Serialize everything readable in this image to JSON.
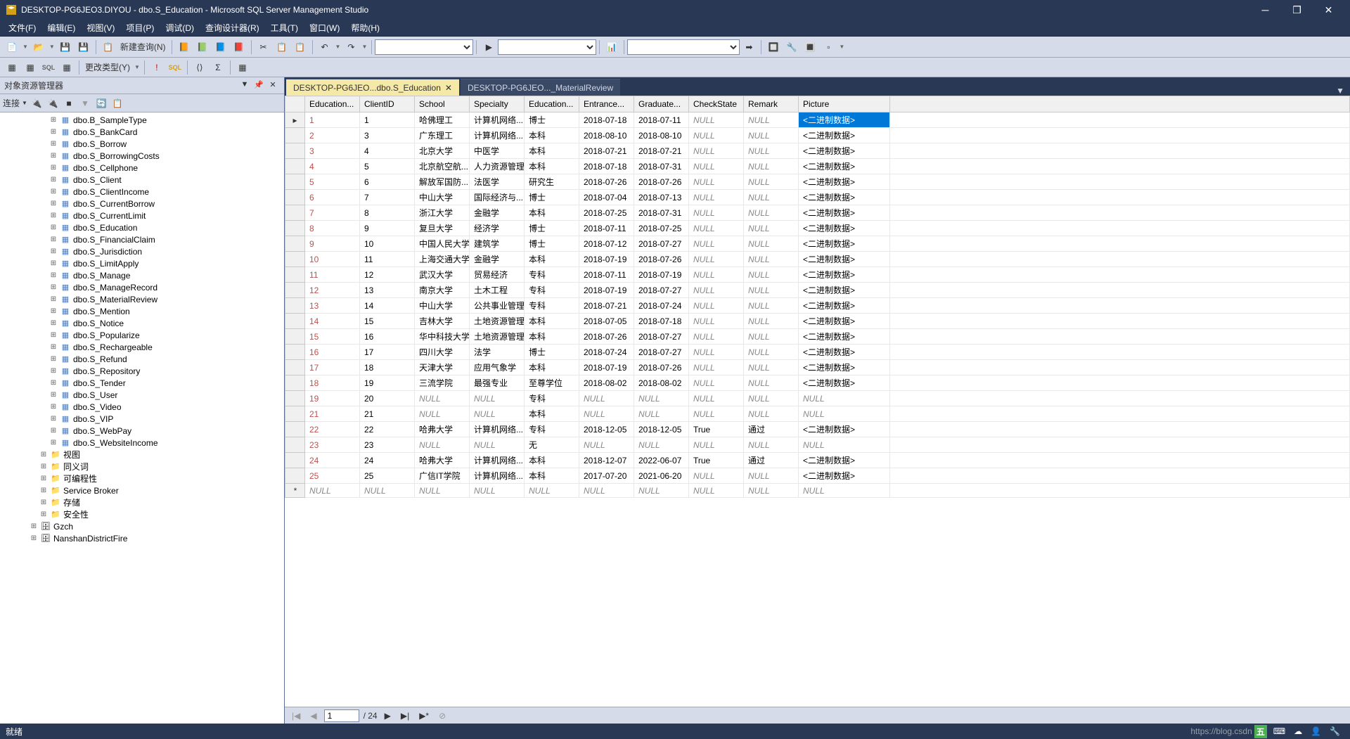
{
  "window": {
    "title": "DESKTOP-PG6JEO3.DIYOU - dbo.S_Education - Microsoft SQL Server Management Studio"
  },
  "menu": {
    "items": [
      "文件(F)",
      "编辑(E)",
      "视图(V)",
      "项目(P)",
      "调试(D)",
      "查询设计器(R)",
      "工具(T)",
      "窗口(W)",
      "帮助(H)"
    ]
  },
  "toolbar": {
    "new_query": "新建查询(N)",
    "change_type": "更改类型(Y)"
  },
  "explorer": {
    "title": "对象资源管理器",
    "connect": "连接",
    "tree": [
      {
        "depth": 3,
        "icon": "table",
        "label": "dbo.B_SampleType"
      },
      {
        "depth": 3,
        "icon": "table",
        "label": "dbo.S_BankCard"
      },
      {
        "depth": 3,
        "icon": "table",
        "label": "dbo.S_Borrow"
      },
      {
        "depth": 3,
        "icon": "table",
        "label": "dbo.S_BorrowingCosts"
      },
      {
        "depth": 3,
        "icon": "table",
        "label": "dbo.S_Cellphone"
      },
      {
        "depth": 3,
        "icon": "table",
        "label": "dbo.S_Client"
      },
      {
        "depth": 3,
        "icon": "table",
        "label": "dbo.S_ClientIncome"
      },
      {
        "depth": 3,
        "icon": "table",
        "label": "dbo.S_CurrentBorrow"
      },
      {
        "depth": 3,
        "icon": "table",
        "label": "dbo.S_CurrentLimit"
      },
      {
        "depth": 3,
        "icon": "table",
        "label": "dbo.S_Education"
      },
      {
        "depth": 3,
        "icon": "table",
        "label": "dbo.S_FinancialClaim"
      },
      {
        "depth": 3,
        "icon": "table",
        "label": "dbo.S_Jurisdiction"
      },
      {
        "depth": 3,
        "icon": "table",
        "label": "dbo.S_LimitApply"
      },
      {
        "depth": 3,
        "icon": "table",
        "label": "dbo.S_Manage"
      },
      {
        "depth": 3,
        "icon": "table",
        "label": "dbo.S_ManageRecord"
      },
      {
        "depth": 3,
        "icon": "table",
        "label": "dbo.S_MaterialReview"
      },
      {
        "depth": 3,
        "icon": "table",
        "label": "dbo.S_Mention"
      },
      {
        "depth": 3,
        "icon": "table",
        "label": "dbo.S_Notice"
      },
      {
        "depth": 3,
        "icon": "table",
        "label": "dbo.S_Popularize"
      },
      {
        "depth": 3,
        "icon": "table",
        "label": "dbo.S_Rechargeable"
      },
      {
        "depth": 3,
        "icon": "table",
        "label": "dbo.S_Refund"
      },
      {
        "depth": 3,
        "icon": "table",
        "label": "dbo.S_Repository"
      },
      {
        "depth": 3,
        "icon": "table",
        "label": "dbo.S_Tender"
      },
      {
        "depth": 3,
        "icon": "table",
        "label": "dbo.S_User"
      },
      {
        "depth": 3,
        "icon": "table",
        "label": "dbo.S_Video"
      },
      {
        "depth": 3,
        "icon": "table",
        "label": "dbo.S_VIP"
      },
      {
        "depth": 3,
        "icon": "table",
        "label": "dbo.S_WebPay"
      },
      {
        "depth": 3,
        "icon": "table",
        "label": "dbo.S_WebsiteIncome"
      },
      {
        "depth": 2,
        "icon": "folder",
        "label": "视图"
      },
      {
        "depth": 2,
        "icon": "folder",
        "label": "同义词"
      },
      {
        "depth": 2,
        "icon": "folder",
        "label": "可编程性"
      },
      {
        "depth": 2,
        "icon": "folder",
        "label": "Service Broker"
      },
      {
        "depth": 2,
        "icon": "folder",
        "label": "存储"
      },
      {
        "depth": 2,
        "icon": "folder",
        "label": "安全性"
      },
      {
        "depth": 1,
        "icon": "db",
        "label": "Gzch"
      },
      {
        "depth": 1,
        "icon": "db",
        "label": "NanshanDistrictFire"
      }
    ]
  },
  "tabs": {
    "items": [
      {
        "label": "DESKTOP-PG6JEO...dbo.S_Education",
        "active": true,
        "closable": true
      },
      {
        "label": "DESKTOP-PG6JEO..._MaterialReview",
        "active": false,
        "closable": false
      }
    ]
  },
  "grid": {
    "columns": [
      "Education...",
      "ClientID",
      "School",
      "Specialty",
      "Education...",
      "Entrance...",
      "Graduate...",
      "CheckState",
      "Remark",
      "Picture"
    ],
    "rows": [
      {
        "cells": [
          "1",
          "1",
          "哈佛理工",
          "计算机网络...",
          "博士",
          "2018-07-18",
          "2018-07-11",
          "NULL",
          "NULL",
          "<二进制数据>"
        ],
        "selected_col": 9
      },
      {
        "cells": [
          "2",
          "3",
          "广东理工",
          "计算机网络...",
          "本科",
          "2018-08-10",
          "2018-08-10",
          "NULL",
          "NULL",
          "<二进制数据>"
        ]
      },
      {
        "cells": [
          "3",
          "4",
          "北京大学",
          "中医学",
          "本科",
          "2018-07-21",
          "2018-07-21",
          "NULL",
          "NULL",
          "<二进制数据>"
        ]
      },
      {
        "cells": [
          "4",
          "5",
          "北京航空航...",
          "人力资源管理",
          "本科",
          "2018-07-18",
          "2018-07-31",
          "NULL",
          "NULL",
          "<二进制数据>"
        ]
      },
      {
        "cells": [
          "5",
          "6",
          "解放军国防...",
          "法医学",
          "研究生",
          "2018-07-26",
          "2018-07-26",
          "NULL",
          "NULL",
          "<二进制数据>"
        ]
      },
      {
        "cells": [
          "6",
          "7",
          "中山大学",
          "国际经济与...",
          "博士",
          "2018-07-04",
          "2018-07-13",
          "NULL",
          "NULL",
          "<二进制数据>"
        ]
      },
      {
        "cells": [
          "7",
          "8",
          "浙江大学",
          "金融学",
          "本科",
          "2018-07-25",
          "2018-07-31",
          "NULL",
          "NULL",
          "<二进制数据>"
        ]
      },
      {
        "cells": [
          "8",
          "9",
          "复旦大学",
          "经济学",
          "博士",
          "2018-07-11",
          "2018-07-25",
          "NULL",
          "NULL",
          "<二进制数据>"
        ]
      },
      {
        "cells": [
          "9",
          "10",
          "中国人民大学",
          "建筑学",
          "博士",
          "2018-07-12",
          "2018-07-27",
          "NULL",
          "NULL",
          "<二进制数据>"
        ]
      },
      {
        "cells": [
          "10",
          "11",
          "上海交通大学",
          "金融学",
          "本科",
          "2018-07-19",
          "2018-07-26",
          "NULL",
          "NULL",
          "<二进制数据>"
        ]
      },
      {
        "cells": [
          "11",
          "12",
          "武汉大学",
          "贸易经济",
          "专科",
          "2018-07-11",
          "2018-07-19",
          "NULL",
          "NULL",
          "<二进制数据>"
        ]
      },
      {
        "cells": [
          "12",
          "13",
          "南京大学",
          "土木工程",
          "专科",
          "2018-07-19",
          "2018-07-27",
          "NULL",
          "NULL",
          "<二进制数据>"
        ]
      },
      {
        "cells": [
          "13",
          "14",
          "中山大学",
          "公共事业管理",
          "专科",
          "2018-07-21",
          "2018-07-24",
          "NULL",
          "NULL",
          "<二进制数据>"
        ]
      },
      {
        "cells": [
          "14",
          "15",
          "吉林大学",
          "土地资源管理",
          "本科",
          "2018-07-05",
          "2018-07-18",
          "NULL",
          "NULL",
          "<二进制数据>"
        ]
      },
      {
        "cells": [
          "15",
          "16",
          "华中科技大学",
          "土地资源管理",
          "本科",
          "2018-07-26",
          "2018-07-27",
          "NULL",
          "NULL",
          "<二进制数据>"
        ]
      },
      {
        "cells": [
          "16",
          "17",
          "四川大学",
          "法学",
          "博士",
          "2018-07-24",
          "2018-07-27",
          "NULL",
          "NULL",
          "<二进制数据>"
        ]
      },
      {
        "cells": [
          "17",
          "18",
          "天津大学",
          "应用气象学",
          "本科",
          "2018-07-19",
          "2018-07-26",
          "NULL",
          "NULL",
          "<二进制数据>"
        ]
      },
      {
        "cells": [
          "18",
          "19",
          "三流学院",
          "最强专业",
          "至尊学位",
          "2018-08-02",
          "2018-08-02",
          "NULL",
          "NULL",
          "<二进制数据>"
        ]
      },
      {
        "cells": [
          "19",
          "20",
          "NULL",
          "NULL",
          "专科",
          "NULL",
          "NULL",
          "NULL",
          "NULL",
          "NULL"
        ]
      },
      {
        "cells": [
          "21",
          "21",
          "NULL",
          "NULL",
          "本科",
          "NULL",
          "NULL",
          "NULL",
          "NULL",
          "NULL"
        ]
      },
      {
        "cells": [
          "22",
          "22",
          "哈弗大学",
          "计算机网络...",
          "专科",
          "2018-12-05",
          "2018-12-05",
          "True",
          "通过",
          "<二进制数据>"
        ]
      },
      {
        "cells": [
          "23",
          "23",
          "NULL",
          "NULL",
          "无",
          "NULL",
          "NULL",
          "NULL",
          "NULL",
          "NULL"
        ]
      },
      {
        "cells": [
          "24",
          "24",
          "哈弗大学",
          "计算机网络...",
          "本科",
          "2018-12-07",
          "2022-06-07",
          "True",
          "通过",
          "<二进制数据>"
        ]
      },
      {
        "cells": [
          "25",
          "25",
          "广信IT学院",
          "计算机网络...",
          "本科",
          "2017-07-20",
          "2021-06-20",
          "NULL",
          "NULL",
          "<二进制数据>"
        ]
      }
    ],
    "new_row": [
      "NULL",
      "NULL",
      "NULL",
      "NULL",
      "NULL",
      "NULL",
      "NULL",
      "NULL",
      "NULL",
      "NULL"
    ]
  },
  "pager": {
    "current": "1",
    "total": "/ 24"
  },
  "status": {
    "ready": "就绪",
    "watermark": "https://blog.csdn",
    "ime": "五"
  }
}
